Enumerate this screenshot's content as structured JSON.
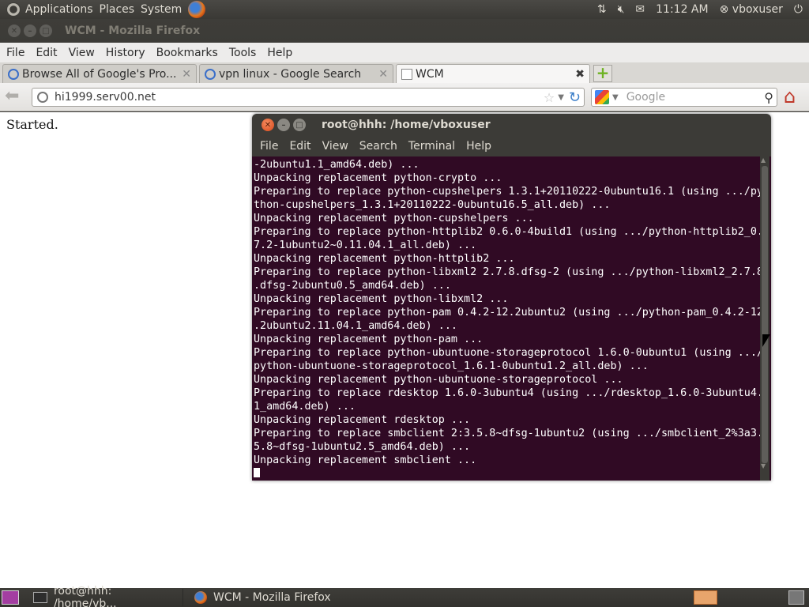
{
  "top_panel": {
    "menus": [
      "Applications",
      "Places",
      "System"
    ],
    "clock": "11:12 AM",
    "user": "vboxuser",
    "icons": [
      "network-icon",
      "volume-muted-icon",
      "mail-icon",
      "user-icon",
      "power-icon"
    ]
  },
  "browser": {
    "window_title": "WCM - Mozilla Firefox",
    "menu": [
      "File",
      "Edit",
      "View",
      "History",
      "Bookmarks",
      "Tools",
      "Help"
    ],
    "tabs": [
      {
        "label": "Browse All of Google's Pro...",
        "active": false
      },
      {
        "label": "vpn linux - Google Search",
        "active": false
      },
      {
        "label": "WCM",
        "active": true
      }
    ],
    "url": "hi1999.serv00.net",
    "search_placeholder": "Google",
    "page_text": "Started."
  },
  "terminal": {
    "title": "root@hhh: /home/vboxuser",
    "menu": [
      "File",
      "Edit",
      "View",
      "Search",
      "Terminal",
      "Help"
    ],
    "lines": [
      "-2ubuntu1.1_amd64.deb) ...",
      "Unpacking replacement python-crypto ...",
      "Preparing to replace python-cupshelpers 1.3.1+20110222-0ubuntu16.1 (using .../py",
      "thon-cupshelpers_1.3.1+20110222-0ubuntu16.5_all.deb) ...",
      "Unpacking replacement python-cupshelpers ...",
      "Preparing to replace python-httplib2 0.6.0-4build1 (using .../python-httplib2_0.",
      "7.2-1ubuntu2~0.11.04.1_all.deb) ...",
      "Unpacking replacement python-httplib2 ...",
      "Preparing to replace python-libxml2 2.7.8.dfsg-2 (using .../python-libxml2_2.7.8",
      ".dfsg-2ubuntu0.5_amd64.deb) ...",
      "Unpacking replacement python-libxml2 ...",
      "Preparing to replace python-pam 0.4.2-12.2ubuntu2 (using .../python-pam_0.4.2-12",
      ".2ubuntu2.11.04.1_amd64.deb) ...",
      "Unpacking replacement python-pam ...",
      "Preparing to replace python-ubuntuone-storageprotocol 1.6.0-0ubuntu1 (using .../",
      "python-ubuntuone-storageprotocol_1.6.1-0ubuntu1.2_all.deb) ...",
      "Unpacking replacement python-ubuntuone-storageprotocol ...",
      "Preparing to replace rdesktop 1.6.0-3ubuntu4 (using .../rdesktop_1.6.0-3ubuntu4.",
      "1_amd64.deb) ...",
      "Unpacking replacement rdesktop ...",
      "Preparing to replace smbclient 2:3.5.8~dfsg-1ubuntu2 (using .../smbclient_2%3a3.",
      "5.8~dfsg-1ubuntu2.5_amd64.deb) ...",
      "Unpacking replacement smbclient ..."
    ]
  },
  "bottom_panel": {
    "tasks": [
      "root@hhh: /home/vb...",
      "WCM - Mozilla Firefox"
    ]
  }
}
